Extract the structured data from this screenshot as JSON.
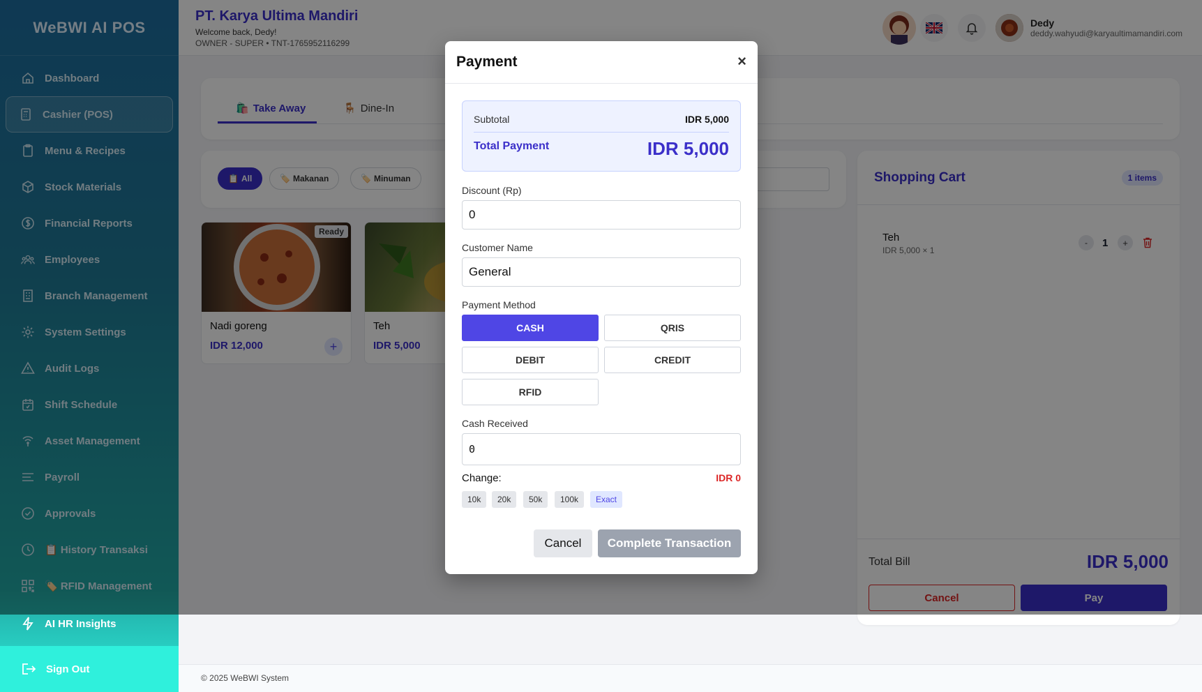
{
  "sidebar": {
    "brand": "WeBWI AI POS",
    "items": [
      {
        "label": "Dashboard",
        "icon": "home-icon"
      },
      {
        "label": "Cashier (POS)",
        "icon": "calculator-icon"
      },
      {
        "label": "Menu & Recipes",
        "icon": "clipboard-icon"
      },
      {
        "label": "Stock Materials",
        "icon": "box-icon"
      },
      {
        "label": "Financial Reports",
        "icon": "dollar-icon"
      },
      {
        "label": "Employees",
        "icon": "users-icon"
      },
      {
        "label": "Branch Management",
        "icon": "building-icon"
      },
      {
        "label": "System Settings",
        "icon": "gear-icon"
      },
      {
        "label": "Audit Logs",
        "icon": "warning-icon"
      },
      {
        "label": "Shift Schedule",
        "icon": "calendar-icon"
      },
      {
        "label": "Asset Management",
        "icon": "signal-icon"
      },
      {
        "label": "Payroll",
        "icon": "lines-icon"
      },
      {
        "label": "Approvals",
        "icon": "check-circle-icon"
      },
      {
        "label": "📋 History Transaksi",
        "icon": "clock-icon"
      },
      {
        "label": "🏷️ RFID Management",
        "icon": "qr-icon"
      }
    ],
    "ai_item": "AI HR Insights",
    "sign_out": "Sign Out"
  },
  "header": {
    "company": "PT. Karya Ultima Mandiri",
    "welcome": "Welcome back, Dedy!",
    "tenant": "OWNER - SUPER • TNT-1765952116299",
    "user_name": "Dedy",
    "user_email": "deddy.wahyudi@karyaultimamandiri.com"
  },
  "tabs": {
    "take_away": "Take Away",
    "dine_in": "Dine-In"
  },
  "categories": {
    "all": "All",
    "makanan": "Makanan",
    "minuman": "Minuman"
  },
  "products": [
    {
      "name": "Nadi goreng",
      "price": "IDR 12,000",
      "badge": "Ready"
    },
    {
      "name": "Teh",
      "price": "IDR 5,000"
    }
  ],
  "cart": {
    "title": "Shopping Cart",
    "count": "1 items",
    "item_name": "Teh",
    "item_detail": "IDR 5,000 × 1",
    "qty": "1",
    "minus": "-",
    "plus": "+",
    "total_label": "Total Bill",
    "total_value": "IDR 5,000",
    "cancel": "Cancel",
    "pay": "Pay"
  },
  "modal": {
    "title": "Payment",
    "close": "×",
    "subtotal_label": "Subtotal",
    "subtotal_value": "IDR 5,000",
    "total_label": "Total Payment",
    "total_value": "IDR 5,000",
    "discount_label": "Discount (Rp)",
    "discount_value": "0",
    "customer_label": "Customer Name",
    "customer_value": "General",
    "method_label": "Payment Method",
    "methods": [
      "CASH",
      "QRIS",
      "DEBIT",
      "CREDIT",
      "RFID"
    ],
    "cash_label": "Cash Received",
    "cash_value": "0",
    "change_label": "Change:",
    "change_value": "IDR 0",
    "quick": [
      "10k",
      "20k",
      "50k",
      "100k",
      "Exact"
    ],
    "cancel": "Cancel",
    "complete": "Complete Transaction"
  },
  "footer": "© 2025 WeBWI System",
  "colors": {
    "accent": "#3b2fc9",
    "primary": "#4f46e5",
    "danger": "#dc2626"
  }
}
